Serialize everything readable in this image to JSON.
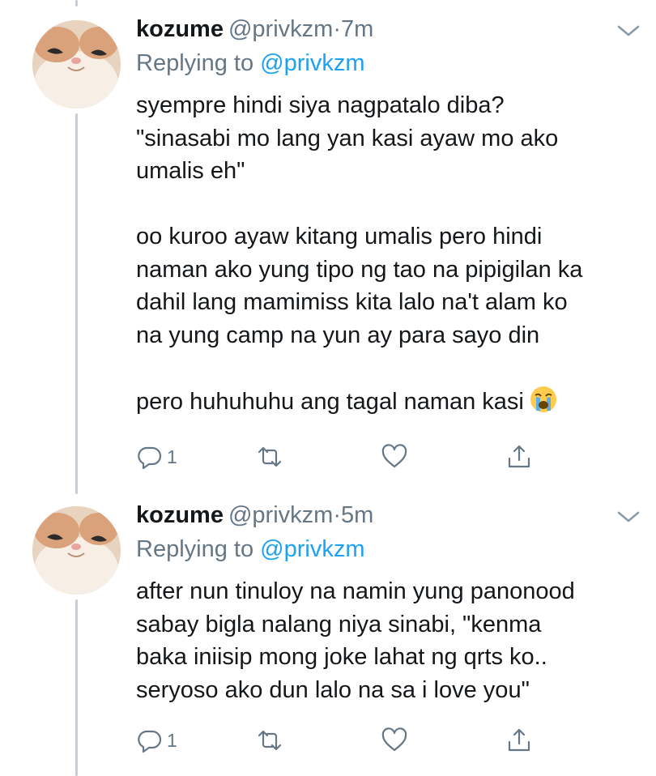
{
  "tweets": [
    {
      "name": "kozume",
      "handle": "@privkzm",
      "dot": "·",
      "time": "7m",
      "reply_prefix": "Replying to",
      "reply_mention": "@privkzm",
      "lines": [
        "syempre hindi siya nagpatalo diba?",
        "\"sinasabi mo lang yan kasi ayaw mo ako",
        "umalis eh\"",
        "",
        "oo kuroo ayaw kitang umalis pero hindi",
        "naman ako yung tipo ng tao na pipigilan ka",
        "dahil lang mamimiss kita lalo na't alam ko",
        "na yung camp na yun ay para sayo din",
        "",
        "pero huhuhuhu ang tagal naman kasi"
      ],
      "trailing_emoji": "loudly-crying-face-emoji",
      "reply_count": "1"
    },
    {
      "name": "kozume",
      "handle": "@privkzm",
      "dot": "·",
      "time": "5m",
      "reply_prefix": "Replying to",
      "reply_mention": "@privkzm",
      "lines": [
        "after nun tinuloy na namin yung panonood",
        "sabay bigla nalang niya sinabi, \"kenma",
        "baka iniisip mong joke lahat ng qrts ko..",
        "seryoso ako dun lalo na sa i love you\""
      ],
      "reply_count": "1"
    }
  ],
  "icons": {
    "reply": "reply-bubble-icon",
    "retweet": "retweet-icon",
    "like": "heart-icon",
    "share": "share-icon",
    "menu": "chevron-down-icon"
  },
  "colors": {
    "text": "#14171a",
    "secondary": "#657786",
    "mention": "#1da1f2",
    "thread_line": "#c4cfd6"
  }
}
